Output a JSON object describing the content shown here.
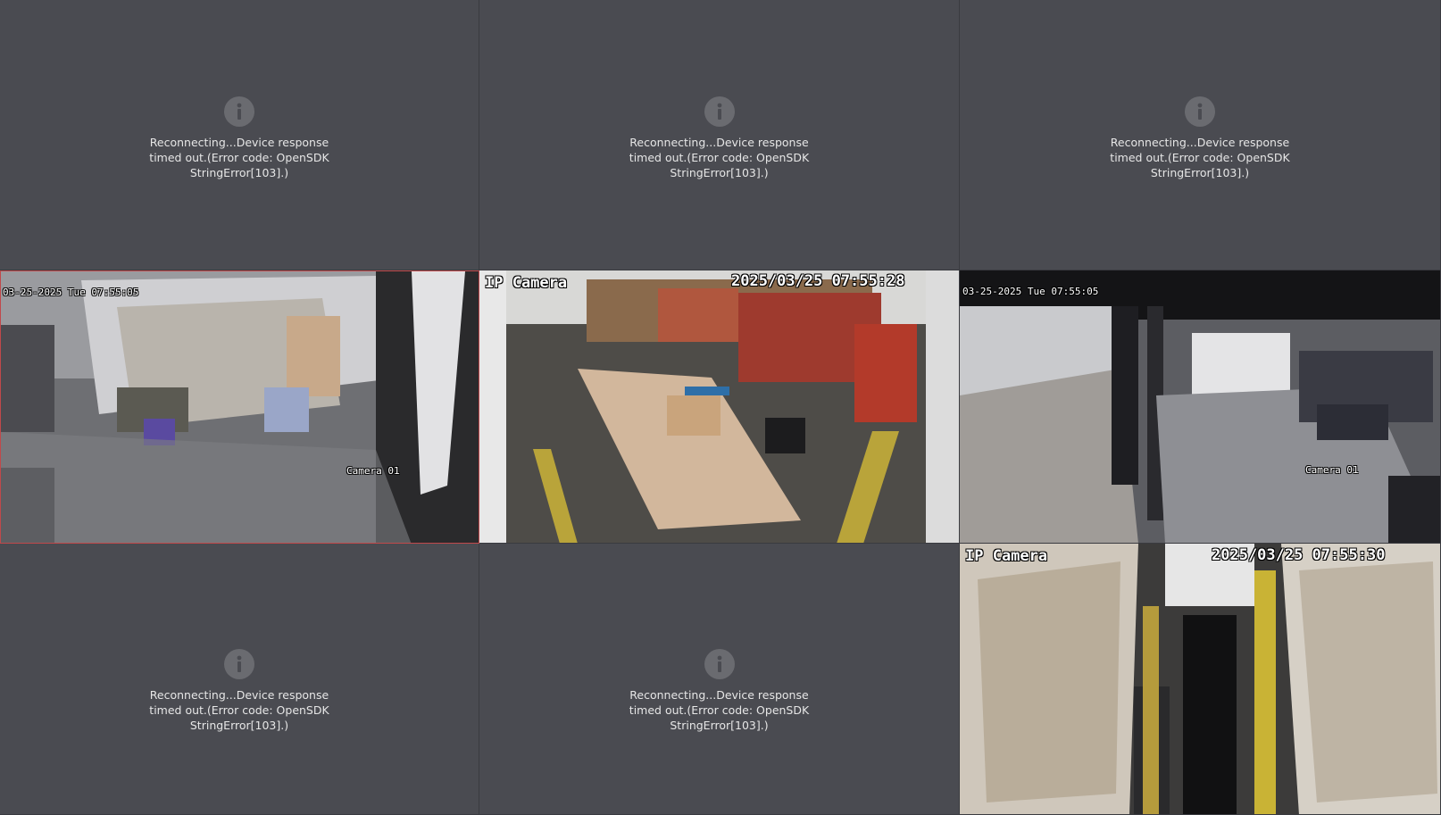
{
  "tiles": [
    {
      "id": "ch1",
      "type": "error",
      "message": "Reconnecting...Device response timed out.(Error code: OpenSDK StringError[103].)",
      "icon": "info-icon"
    },
    {
      "id": "ch2",
      "type": "error",
      "message": "Reconnecting...Device response timed out.(Error code: OpenSDK StringError[103].)",
      "icon": "info-icon"
    },
    {
      "id": "ch3",
      "type": "error",
      "message": "Reconnecting...Device response timed out.(Error code: OpenSDK StringError[103].)",
      "icon": "info-icon"
    },
    {
      "id": "ch4",
      "type": "feed",
      "selected": true,
      "timestamp": "03-25-2025 Tue 07:55:05",
      "label": "Camera 01"
    },
    {
      "id": "ch5",
      "type": "feed",
      "camera_name": "IP Camera",
      "timestamp": "2025/03/25 07:55:28"
    },
    {
      "id": "ch6",
      "type": "feed",
      "timestamp": "03-25-2025 Tue 07:55:05",
      "label": "Camera 01"
    },
    {
      "id": "ch7",
      "type": "error",
      "message": "Reconnecting...Device response timed out.(Error code: OpenSDK StringError[103].)",
      "icon": "info-icon"
    },
    {
      "id": "ch8",
      "type": "error",
      "message": "Reconnecting...Device response timed out.(Error code: OpenSDK StringError[103].)",
      "icon": "info-icon"
    },
    {
      "id": "ch9",
      "type": "feed",
      "camera_name": "IP Camera",
      "timestamp": "2025/03/25 07:55:30"
    }
  ],
  "colors": {
    "tile_bg": "#4a4b51",
    "selected_border": "#c0494b",
    "icon_bg": "#6a6b70"
  }
}
